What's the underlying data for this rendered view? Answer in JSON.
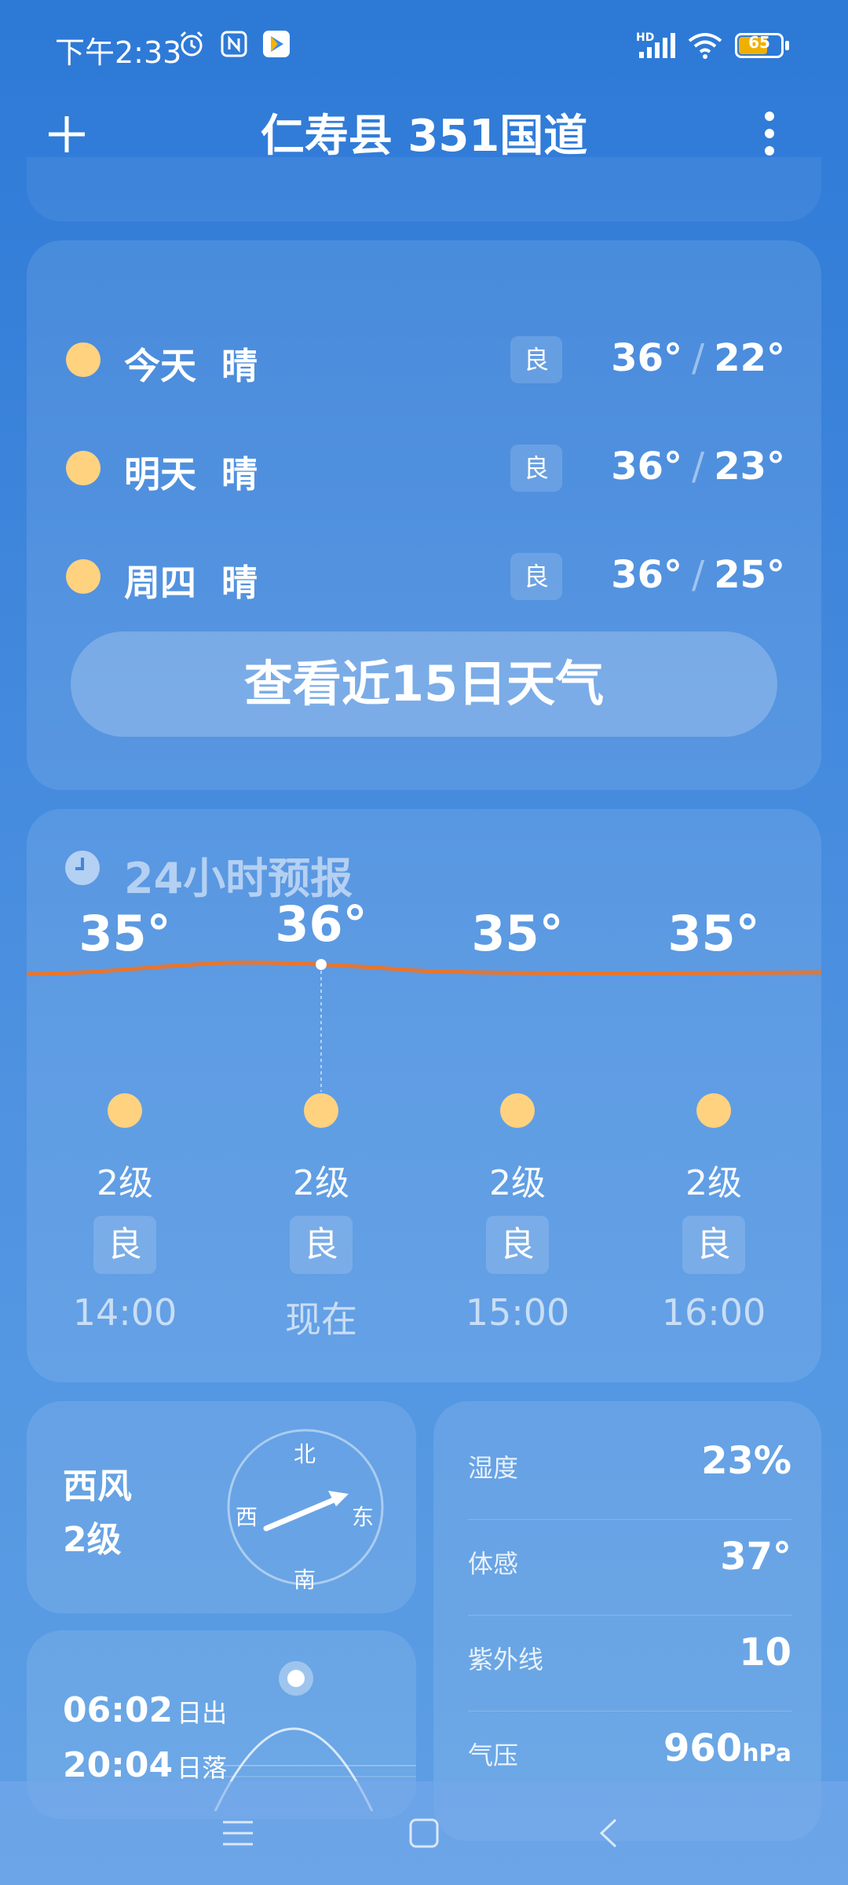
{
  "status_bar": {
    "time": "下午2:33",
    "network": "HD",
    "battery": "65",
    "icons": [
      "alarm-icon",
      "nfc-icon",
      "play-store-icon",
      "signal-icon",
      "wifi-icon",
      "battery-icon"
    ]
  },
  "header": {
    "title": "仁寿县 351国道",
    "add_icon": "plus-icon",
    "menu_icon": "more-vertical-icon"
  },
  "daily": [
    {
      "day": "今天",
      "condition": "晴",
      "aqi": "良",
      "high": "36°",
      "low": "22°"
    },
    {
      "day": "明天",
      "condition": "晴",
      "aqi": "良",
      "high": "36°",
      "low": "23°"
    },
    {
      "day": "周四",
      "condition": "晴",
      "aqi": "良",
      "high": "36°",
      "low": "25°"
    }
  ],
  "daily_separator": "/",
  "forecast_button": "查看近15日天气",
  "hourly": {
    "title": "24小时预报",
    "items": [
      {
        "temp": "35°",
        "value": 35,
        "wind": "2级",
        "aqi": "良",
        "time": "14:00"
      },
      {
        "temp": "36°",
        "value": 36,
        "wind": "2级",
        "aqi": "良",
        "time": "现在"
      },
      {
        "temp": "35°",
        "value": 35,
        "wind": "2级",
        "aqi": "良",
        "time": "15:00"
      },
      {
        "temp": "35°",
        "value": 35,
        "wind": "2级",
        "aqi": "良",
        "time": "16:00"
      }
    ]
  },
  "wind": {
    "direction": "西风",
    "level": "2级",
    "compass": {
      "n": "北",
      "s": "南",
      "w": "西",
      "e": "东"
    }
  },
  "sun": {
    "sunrise": "06:02",
    "sunrise_label": "日出",
    "sunset": "20:04",
    "sunset_label": "日落"
  },
  "details": [
    {
      "label": "湿度",
      "value": "23%"
    },
    {
      "label": "体感",
      "value": "37°"
    },
    {
      "label": "紫外线",
      "value": "10"
    },
    {
      "label": "气压",
      "value": "960",
      "unit": "hPa"
    }
  ],
  "colors": {
    "accent_line": "#e8752d",
    "sun": "#ffd280"
  }
}
